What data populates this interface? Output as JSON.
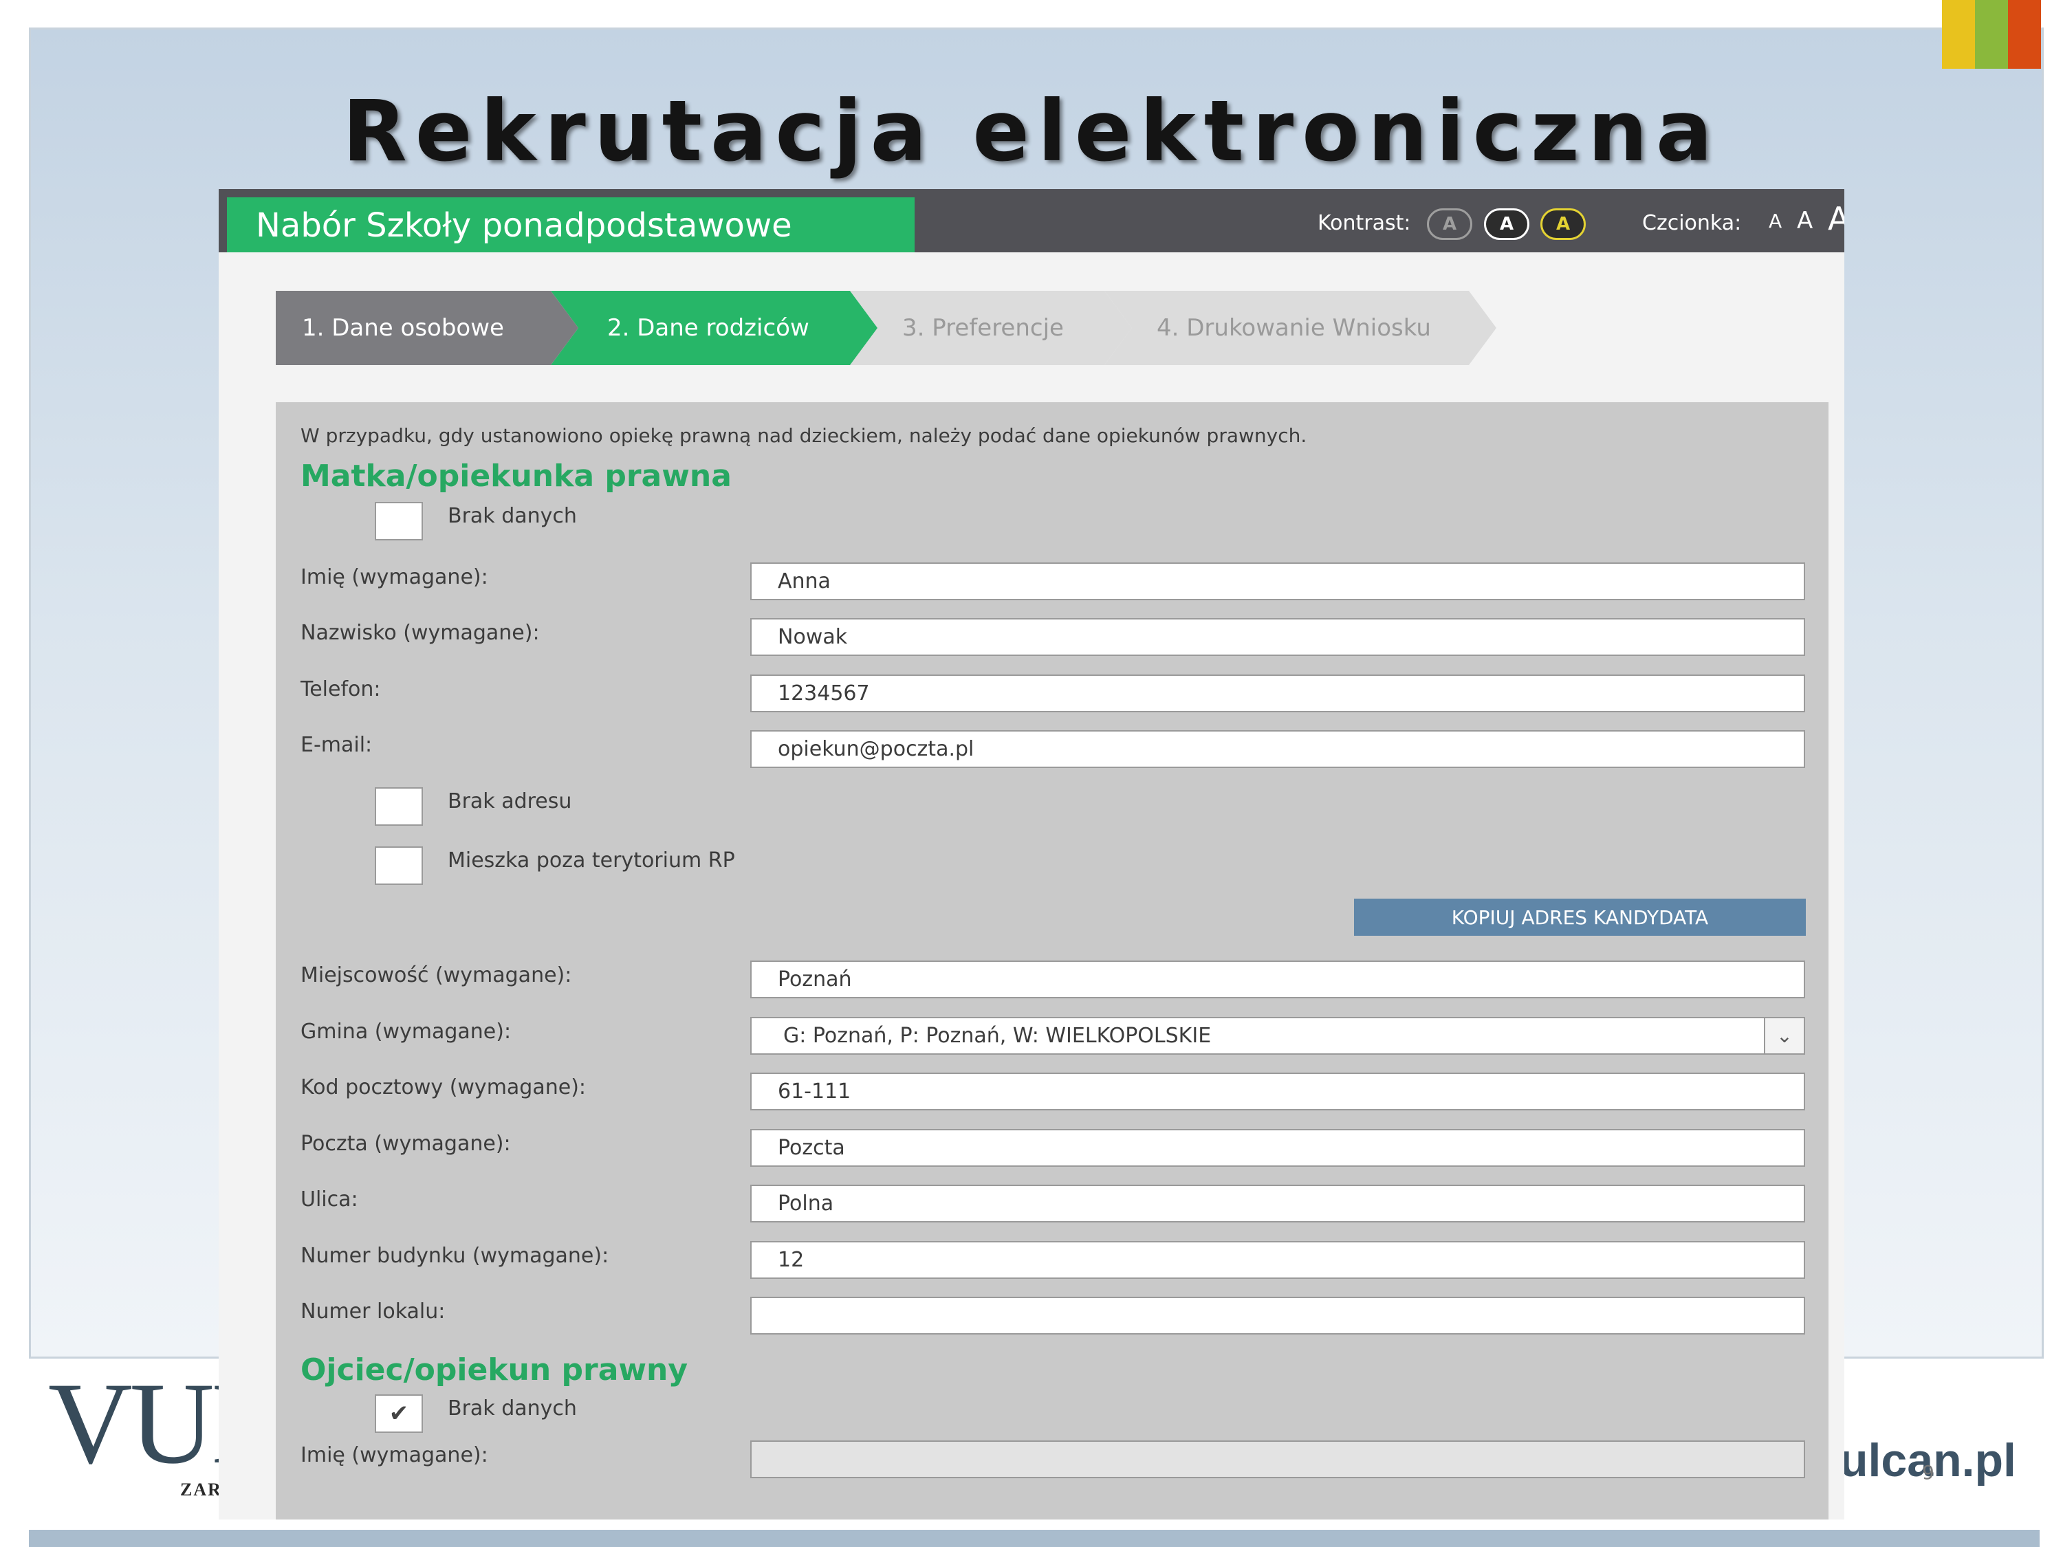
{
  "slide": {
    "title": "Rekrutacja elektroniczna",
    "logo_left": "VUL",
    "logo_left_sub": "ZARZ",
    "logo_right": "ulcan.pl",
    "page_number": "9",
    "stripe_colors": [
      "#e8c21e",
      "#8ab83c",
      "#d84b12"
    ]
  },
  "app": {
    "title": "Nabór Szkoły ponadpodstawowe",
    "contrast_label": "Kontrast:",
    "contrast_options": [
      "A",
      "A",
      "A"
    ],
    "font_label": "Czcionka:",
    "font_sizes": [
      "A",
      "A",
      "A"
    ],
    "accent_color": "#27b668"
  },
  "steps": [
    {
      "label": "1. Dane osobowe",
      "state": "done"
    },
    {
      "label": "2. Dane rodziców",
      "state": "active"
    },
    {
      "label": "3. Preferencje",
      "state": "pending"
    },
    {
      "label": "4. Drukowanie Wniosku",
      "state": "pending"
    }
  ],
  "form": {
    "info": "W przypadku, gdy ustanowiono opiekę prawną nad dzieckiem, należy podać dane opiekunów prawnych.",
    "mother": {
      "title": "Matka/opiekunka prawna",
      "no_data_label": "Brak danych",
      "no_data_checked": false,
      "fields": [
        {
          "label": "Imię (wymagane):",
          "value": "Anna"
        },
        {
          "label": "Nazwisko (wymagane):",
          "value": "Nowak"
        },
        {
          "label": "Telefon:",
          "value": "1234567"
        },
        {
          "label": "E-mail:",
          "value": "opiekun@poczta.pl"
        }
      ],
      "no_address_label": "Brak adresu",
      "abroad_label": "Mieszka poza terytorium RP",
      "copy_button": "KOPIUJ ADRES KANDYDATA",
      "address_fields": [
        {
          "label": "Miejscowość (wymagane):",
          "value": "Poznań"
        },
        {
          "label": "Gmina (wymagane):",
          "value": "G: Poznań, P: Poznań, W: WIELKOPOLSKIE",
          "type": "select"
        },
        {
          "label": "Kod pocztowy (wymagane):",
          "value": "61-111"
        },
        {
          "label": "Poczta (wymagane):",
          "value": "Pozcta"
        },
        {
          "label": "Ulica:",
          "value": "Polna"
        },
        {
          "label": "Numer budynku (wymagane):",
          "value": "12"
        },
        {
          "label": "Numer lokalu:",
          "value": ""
        }
      ]
    },
    "father": {
      "title": "Ojciec/opiekun prawny",
      "no_data_label": "Brak danych",
      "no_data_checked": true,
      "first_name_label": "Imię (wymagane):",
      "first_name_value": ""
    }
  }
}
